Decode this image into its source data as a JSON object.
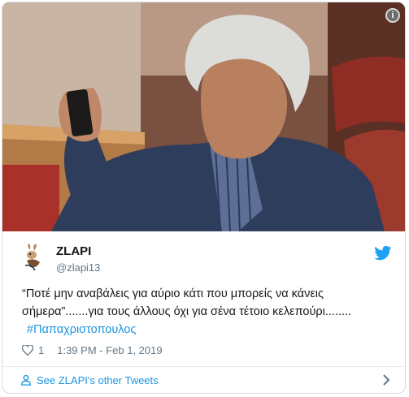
{
  "tweet": {
    "author_name": "ZLAPI",
    "author_handle": "@zlapi13",
    "text": "“Ποτέ μην αναβάλεις για αύριο κάτι που μπορείς να κάνεις σήμερα”.......για τους άλλους όχι για σένα τέτοιο κελεπούρι........",
    "hashtag": "#Παπαχριστοπουλος",
    "like_count": "1",
    "timestamp": "1:39 PM - Feb 1, 2019",
    "footer_link": "See ZLAPI's other Tweets"
  },
  "icons": {
    "info": "info-icon",
    "twitter": "twitter-bird-icon",
    "like": "heart-icon",
    "person": "person-icon",
    "chevron": "chevron-right-icon"
  },
  "colors": {
    "link": "#1b95e0",
    "secondary_text": "#657786",
    "primary_text": "#14171a",
    "border": "#d6dbe0"
  }
}
